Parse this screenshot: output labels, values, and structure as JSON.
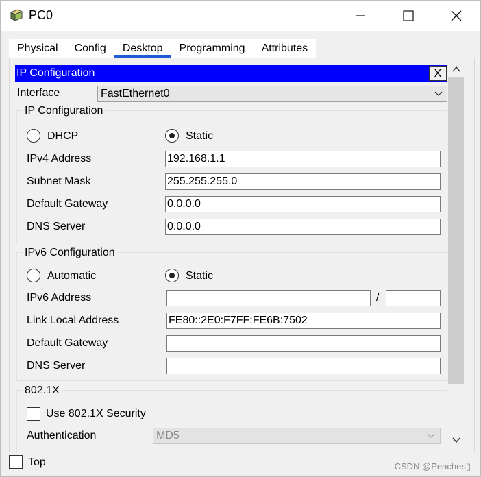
{
  "window": {
    "title": "PC0"
  },
  "tabs": [
    "Physical",
    "Config",
    "Desktop",
    "Programming",
    "Attributes"
  ],
  "active_tab": "Desktop",
  "ip_config": {
    "header": "IP Configuration",
    "close_label": "X",
    "interface_label": "Interface",
    "interface_value": "FastEthernet0",
    "ipv4": {
      "title": "IP Configuration",
      "dhcp_label": "DHCP",
      "static_label": "Static",
      "mode": "Static",
      "ipv4_address_label": "IPv4 Address",
      "ipv4_address": "192.168.1.1",
      "subnet_mask_label": "Subnet Mask",
      "subnet_mask": "255.255.255.0",
      "default_gateway_label": "Default Gateway",
      "default_gateway": "0.0.0.0",
      "dns_server_label": "DNS Server",
      "dns_server": "0.0.0.0"
    },
    "ipv6": {
      "title": "IPv6 Configuration",
      "automatic_label": "Automatic",
      "static_label": "Static",
      "mode": "Static",
      "ipv6_address_label": "IPv6 Address",
      "ipv6_address": "",
      "prefix_separator": "/",
      "prefix_length": "",
      "link_local_label": "Link Local Address",
      "link_local": "FE80::2E0:F7FF:FE6B:7502",
      "default_gateway_label": "Default Gateway",
      "default_gateway": "",
      "dns_server_label": "DNS Server",
      "dns_server": ""
    },
    "dot1x": {
      "title": "802.1X",
      "use_security_label": "Use 802.1X Security",
      "use_security": false,
      "authentication_label": "Authentication",
      "authentication_value": "MD5"
    }
  },
  "bottom": {
    "top_label": "Top",
    "top_checked": false
  },
  "watermark": "CSDN @Peaches▯",
  "colors": {
    "header_bg": "#0000ff",
    "active_tab_underline": "#1f5bd6"
  }
}
